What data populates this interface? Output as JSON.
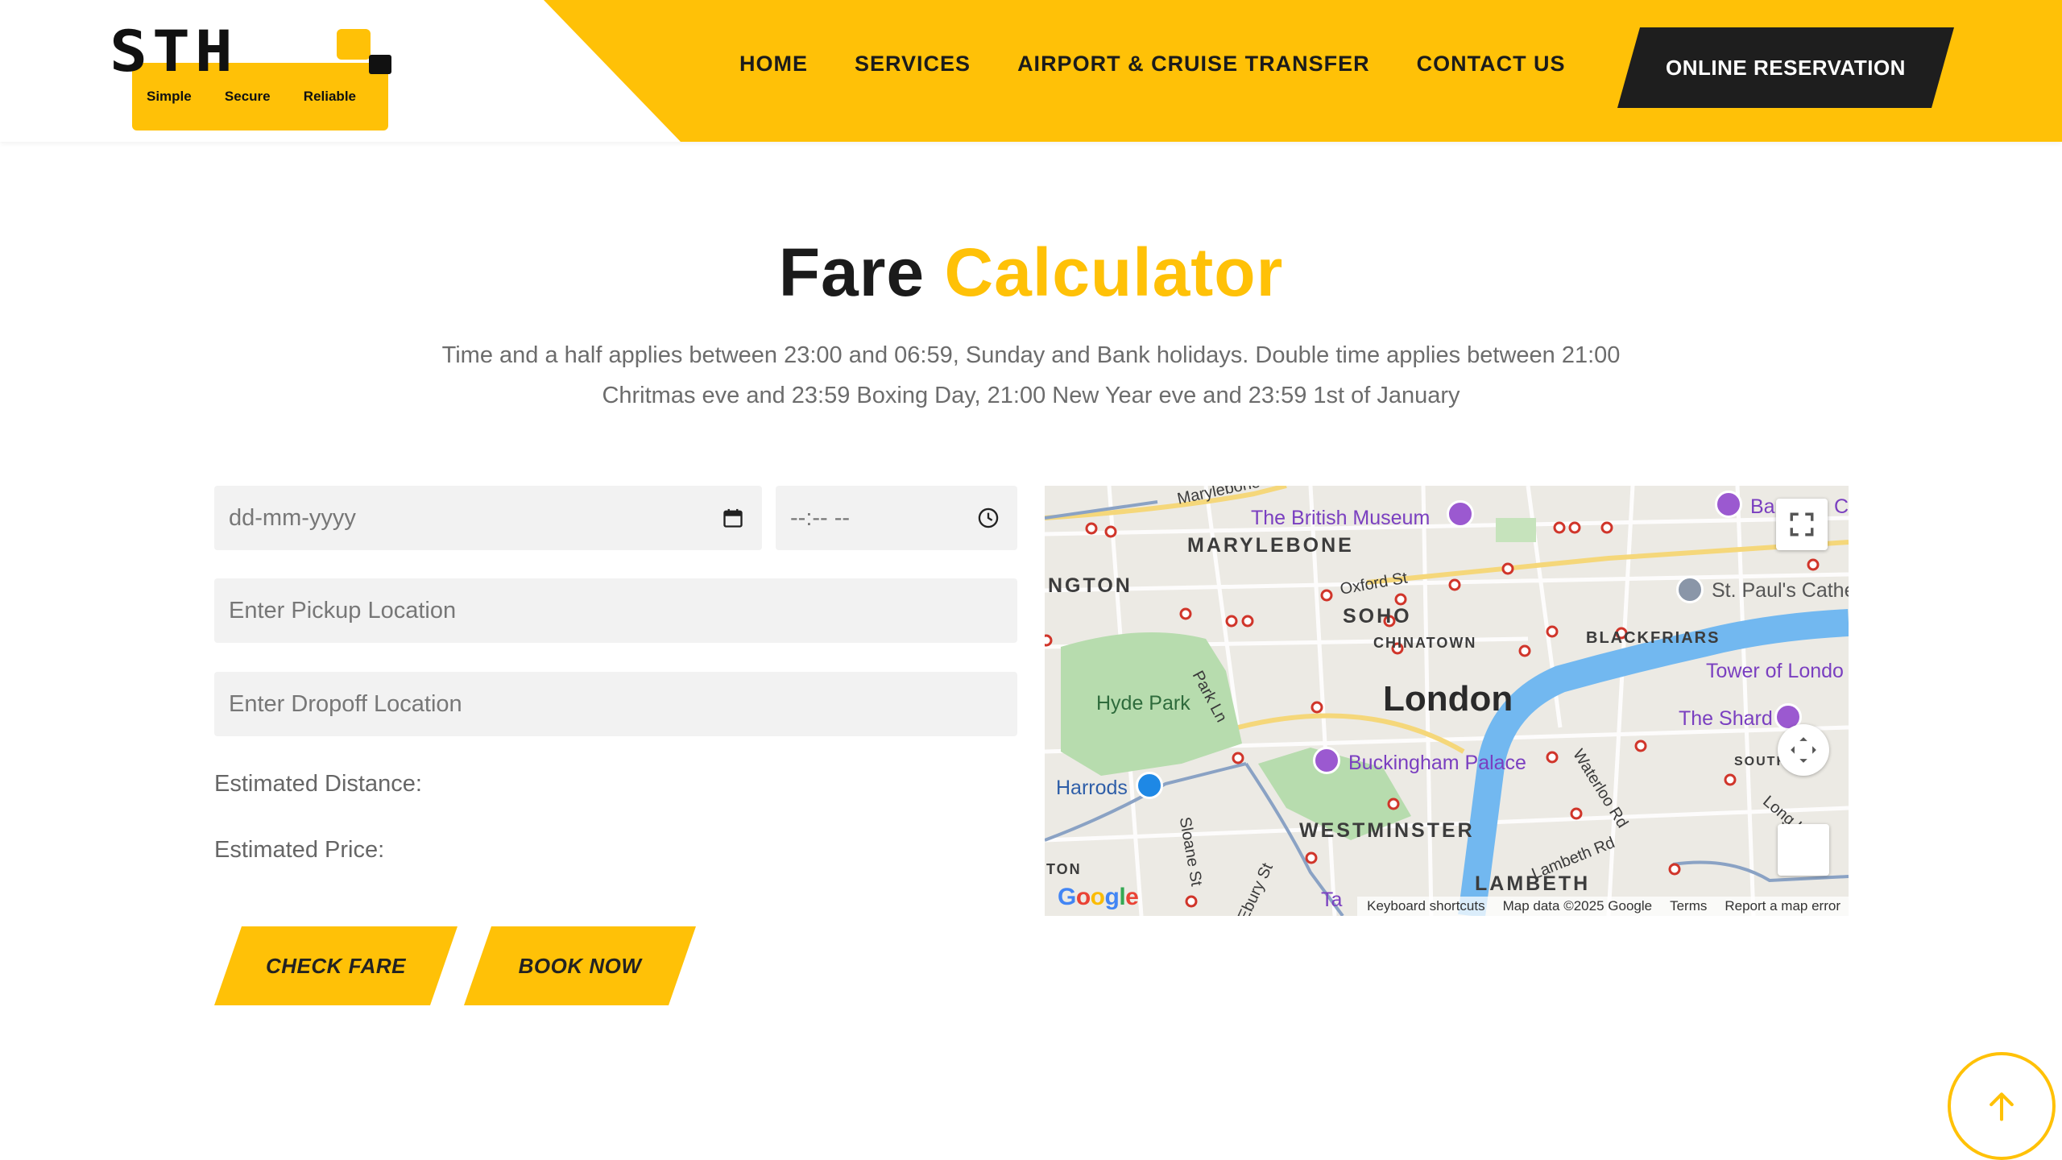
{
  "brand": {
    "logo_text": "STH",
    "tagline": [
      "Simple",
      "Secure",
      "Reliable"
    ],
    "accent_color": "#ffc107",
    "dark_color": "#1e1e1e"
  },
  "nav": {
    "items": [
      "HOME",
      "SERVICES",
      "AIRPORT & CRUISE TRANSFER",
      "CONTACT US"
    ],
    "cta": "ONLINE RESERVATION"
  },
  "page": {
    "title_part1": "Fare",
    "title_part2": "Calculator",
    "subtitle_line1": "Time and a half applies between 23:00 and 06:59, Sunday and Bank holidays. Double time applies between 21:00",
    "subtitle_line2": "Chritmas eve and 23:59 Boxing Day, 21:00 New Year eve and 23:59 1st of January"
  },
  "form": {
    "date": {
      "placeholder": "dd-mm-yyyy",
      "value": "",
      "icon": "calendar-icon"
    },
    "time": {
      "placeholder": "--:-- --",
      "value": "",
      "icon": "clock-icon"
    },
    "pickup": {
      "placeholder": "Enter Pickup Location",
      "value": ""
    },
    "dropoff": {
      "placeholder": "Enter Dropoff Location",
      "value": ""
    },
    "distance_label": "Estimated Distance:",
    "price_label": "Estimated Price:",
    "check_button": "CHECK FARE",
    "book_button": "BOOK NOW"
  },
  "map": {
    "city": "London",
    "areas": [
      "MARYLEBONE",
      "NGTON",
      "SOHO",
      "CHINATOWN",
      "BLACKFRIARS",
      "WESTMINSTER",
      "LAMBETH",
      "SOUTH",
      "TON"
    ],
    "pois": [
      "The British Museum",
      "St. Paul's Cathe",
      "Tower of Londo",
      "The Shard",
      "Buckingham Palace",
      "Harrods",
      "Hyde Park",
      "Ba",
      "C",
      "Ta"
    ],
    "streets": [
      "Marylebone Rd",
      "Oxford St",
      "Park Ln",
      "Sloane St",
      "Ebury St",
      "Waterloo Rd",
      "Lambeth Rd",
      "Long Ln",
      "Tate Britain"
    ],
    "footer": [
      "Keyboard shortcuts",
      "Map data ©2025 Google",
      "Terms",
      "Report a map error"
    ],
    "provider": "Google"
  },
  "scroll_top_icon": "arrow-up-icon"
}
